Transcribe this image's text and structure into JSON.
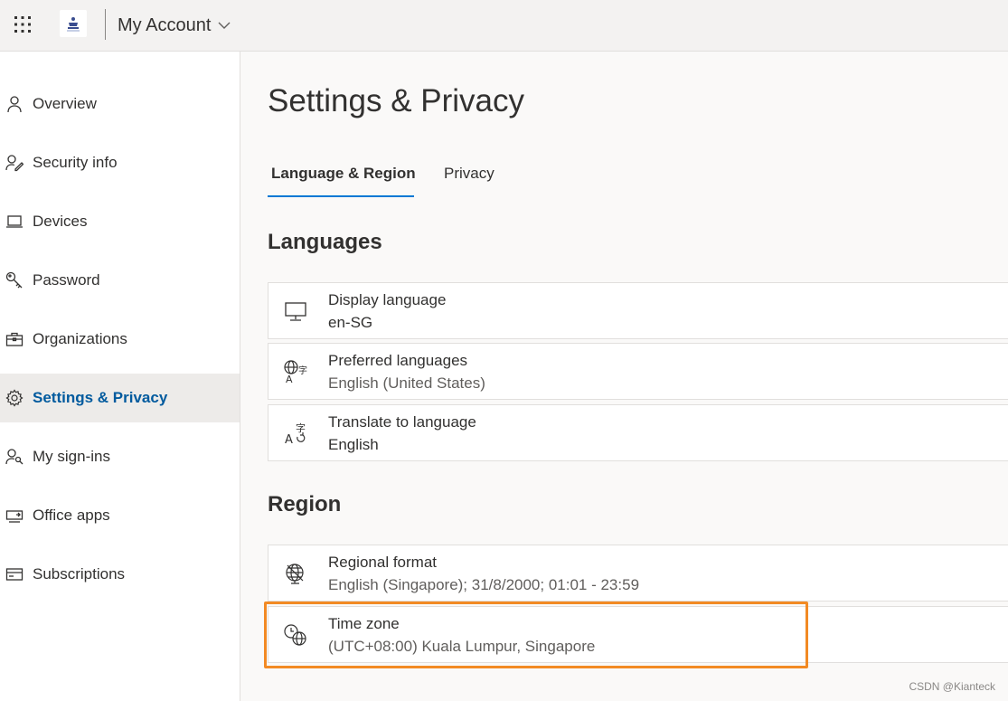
{
  "header": {
    "title": "My Account",
    "icons": {
      "waffle": "app-launcher-icon",
      "chevron": "chevron-down-icon",
      "logo": "organization-logo"
    }
  },
  "sidebar": {
    "items": [
      {
        "label": "Overview",
        "icon": "person-icon",
        "active": false
      },
      {
        "label": "Security info",
        "icon": "security-info-icon",
        "active": false
      },
      {
        "label": "Devices",
        "icon": "laptop-icon",
        "active": false
      },
      {
        "label": "Password",
        "icon": "key-icon",
        "active": false
      },
      {
        "label": "Organizations",
        "icon": "briefcase-icon",
        "active": false
      },
      {
        "label": "Settings & Privacy",
        "icon": "gear-icon",
        "active": true
      },
      {
        "label": "My sign-ins",
        "icon": "sign-ins-icon",
        "active": false
      },
      {
        "label": "Office apps",
        "icon": "office-apps-icon",
        "active": false
      },
      {
        "label": "Subscriptions",
        "icon": "subscriptions-icon",
        "active": false
      }
    ]
  },
  "main": {
    "title": "Settings & Privacy",
    "tabs": [
      {
        "label": "Language & Region",
        "selected": true
      },
      {
        "label": "Privacy",
        "selected": false
      }
    ],
    "languages": {
      "heading": "Languages",
      "items": [
        {
          "title": "Display language",
          "value": "en-SG",
          "icon": "monitor-icon"
        },
        {
          "title": "Preferred languages",
          "value": "English (United States)",
          "icon": "language-globe-icon"
        },
        {
          "title": "Translate to language",
          "value": "English",
          "icon": "translate-icon"
        }
      ]
    },
    "region": {
      "heading": "Region",
      "items": [
        {
          "title": "Regional format",
          "value": "English (Singapore); 31/8/2000; 01:01 - 23:59",
          "icon": "globe-format-icon"
        },
        {
          "title": "Time zone",
          "value": "(UTC+08:00) Kuala Lumpur, Singapore",
          "icon": "time-zone-icon"
        }
      ]
    }
  },
  "colors": {
    "accent": "#0078d4",
    "active_text": "#005a9e",
    "highlight": "#f28a24",
    "topbar_bg": "#f3f2f1",
    "active_nav_bg": "#edebe9"
  },
  "watermark": "CSDN @Kianteck"
}
